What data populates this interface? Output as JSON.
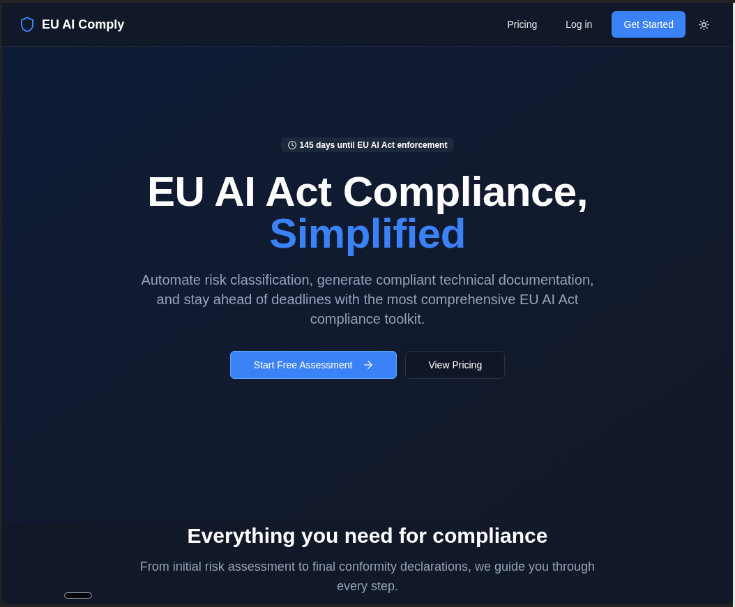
{
  "nav": {
    "brand": "EU AI Comply",
    "links": [
      {
        "label": "Pricing"
      },
      {
        "label": "Log in"
      }
    ],
    "cta": "Get Started"
  },
  "hero": {
    "badge": "145 days until EU AI Act enforcement",
    "title": "EU AI Act Compliance,",
    "title_highlight": "Simplified",
    "description": "Automate risk classification, generate compliant technical documentation, and stay ahead of deadlines with the most comprehensive EU AI Act compliance toolkit.",
    "buttons": [
      {
        "label": "Start Free Assessment",
        "kind": "primary"
      },
      {
        "label": "View Pricing",
        "kind": "outline"
      }
    ]
  },
  "features": {
    "heading": "Everything you need for compliance",
    "description": "From initial risk assessment to final conformity declarations, we guide you through every step."
  }
}
